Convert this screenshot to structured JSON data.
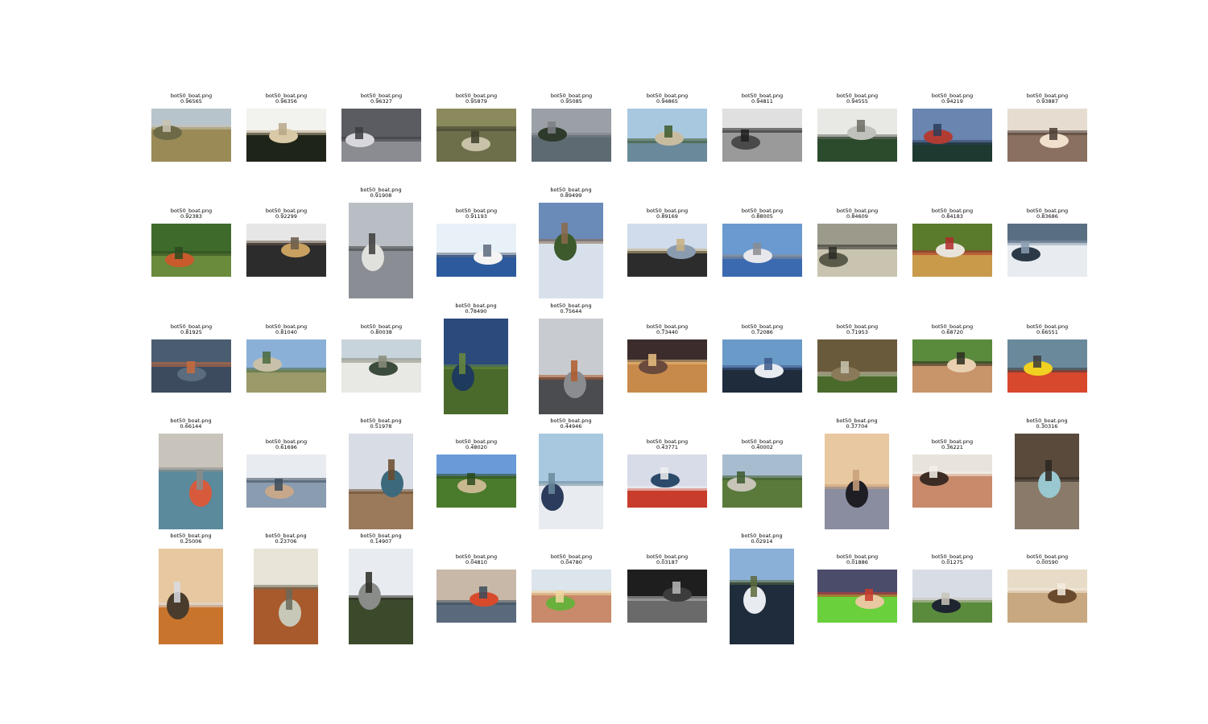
{
  "figure": {
    "cells": [
      {
        "file": "bot50_boat.png",
        "score": "0.96565",
        "orient": "land",
        "palette": [
          "#b8c4cc",
          "#9a8a56",
          "#6d6a48",
          "#c9c3b0"
        ],
        "icon": "landscape-photo"
      },
      {
        "file": "bot50_boat.png",
        "score": "0.96356",
        "orient": "land",
        "palette": [
          "#f2f2ee",
          "#1e2418",
          "#d9c9a6",
          "#b8a888"
        ],
        "icon": "landscape-photo"
      },
      {
        "file": "bot50_boat.png",
        "score": "0.96327",
        "orient": "land",
        "palette": [
          "#5a5c62",
          "#8a8c92",
          "#d8d8dc",
          "#3c3c40"
        ],
        "icon": "landscape-photo"
      },
      {
        "file": "bot50_boat.png",
        "score": "0.95879",
        "orient": "land",
        "palette": [
          "#8a8a5c",
          "#6d6e4a",
          "#c8c2a8",
          "#3e3e2c"
        ],
        "icon": "landscape-photo"
      },
      {
        "file": "bot50_boat.png",
        "score": "0.95085",
        "orient": "land",
        "palette": [
          "#9aa0a6",
          "#5e6a72",
          "#2e3a2c",
          "#7c8086"
        ],
        "icon": "landscape-photo"
      },
      {
        "file": "bot50_boat.png",
        "score": "0.94865",
        "orient": "land",
        "palette": [
          "#a8c8e0",
          "#6a8a9c",
          "#c8bca0",
          "#3e5a2c"
        ],
        "icon": "landscape-photo"
      },
      {
        "file": "bot50_boat.png",
        "score": "0.94811",
        "orient": "land",
        "palette": [
          "#e0e0e0",
          "#9a9a9a",
          "#4a4a4a",
          "#1e1e1e"
        ],
        "icon": "landscape-photo"
      },
      {
        "file": "bot50_boat.png",
        "score": "0.94555",
        "orient": "land",
        "palette": [
          "#e8e8e4",
          "#2c4a2c",
          "#c0c0bc",
          "#6c6c64"
        ],
        "icon": "landscape-photo"
      },
      {
        "file": "bot50_boat.png",
        "score": "0.94219",
        "orient": "land",
        "palette": [
          "#6a86b0",
          "#1e3a30",
          "#b03c34",
          "#2c3e5c"
        ],
        "icon": "landscape-photo"
      },
      {
        "file": "bot50_boat.png",
        "score": "0.93887",
        "orient": "land",
        "palette": [
          "#e6dcd0",
          "#8a7060",
          "#f0e0cc",
          "#4a3c34"
        ],
        "icon": "landscape-photo"
      },
      {
        "file": "bot50_boat.png",
        "score": "0.92383",
        "orient": "land",
        "palette": [
          "#3e6a2c",
          "#6a8a3c",
          "#c85a2c",
          "#2c4a1e"
        ],
        "icon": "landscape-photo"
      },
      {
        "file": "bot50_boat.png",
        "score": "0.92299",
        "orient": "land",
        "palette": [
          "#e6e6e6",
          "#2c2c2c",
          "#c8a060",
          "#6a5a48"
        ],
        "icon": "landscape-photo"
      },
      {
        "file": "bot50_boat.png",
        "score": "0.91908",
        "orient": "tall",
        "palette": [
          "#b8bec4",
          "#8a8e94",
          "#e0e0dc",
          "#3c3c3c"
        ],
        "icon": "portrait-photo"
      },
      {
        "file": "bot50_boat.png",
        "score": "0.91193",
        "orient": "land",
        "palette": [
          "#e8f0f8",
          "#2c5a9c",
          "#f4f4f4",
          "#5a6a7c"
        ],
        "icon": "landscape-photo"
      },
      {
        "file": "bot50_boat.png",
        "score": "0.89499",
        "orient": "tall",
        "palette": [
          "#6a8ab8",
          "#d8e0ec",
          "#3c5a2c",
          "#8a6a4a"
        ],
        "icon": "portrait-photo"
      },
      {
        "file": "bot50_boat.png",
        "score": "0.89169",
        "orient": "land",
        "palette": [
          "#d0dcec",
          "#2c2c2c",
          "#8a9cb0",
          "#c8b080"
        ],
        "icon": "landscape-photo"
      },
      {
        "file": "bot50_boat.png",
        "score": "0.88005",
        "orient": "land",
        "palette": [
          "#6a9ad0",
          "#3c6ab0",
          "#e8e8ec",
          "#8a8c90"
        ],
        "icon": "landscape-photo"
      },
      {
        "file": "bot50_boat.png",
        "score": "0.84609",
        "orient": "land",
        "palette": [
          "#9c9a8a",
          "#c8c4b0",
          "#5a5a4a",
          "#2c2c24"
        ],
        "icon": "landscape-photo"
      },
      {
        "file": "bot50_boat.png",
        "score": "0.84183",
        "orient": "land",
        "palette": [
          "#5a7a2c",
          "#c89a4a",
          "#e8e4dc",
          "#b02c2c"
        ],
        "icon": "landscape-photo"
      },
      {
        "file": "bot50_boat.png",
        "score": "0.83686",
        "orient": "land",
        "palette": [
          "#5a6e82",
          "#e8ecf0",
          "#2c3a48",
          "#8a9cb0"
        ],
        "icon": "landscape-photo"
      },
      {
        "file": "bot50_boat.png",
        "score": "0.81925",
        "orient": "land",
        "palette": [
          "#4a5c70",
          "#3c4c5e",
          "#5a6c7e",
          "#c86a3c"
        ],
        "icon": "landscape-photo"
      },
      {
        "file": "bot50_boat.png",
        "score": "0.81040",
        "orient": "land",
        "palette": [
          "#8ab0d8",
          "#9a9a6a",
          "#c8c0a8",
          "#4a6a3c"
        ],
        "icon": "landscape-photo"
      },
      {
        "file": "bot50_boat.png",
        "score": "0.80038",
        "orient": "land",
        "palette": [
          "#c8d4dc",
          "#e8e8e4",
          "#3c4c3c",
          "#8a8c7c"
        ],
        "icon": "landscape-photo"
      },
      {
        "file": "bot50_boat.png",
        "score": "0.78490",
        "orient": "tall",
        "palette": [
          "#2c4a7c",
          "#4a6a2c",
          "#1e3a5c",
          "#6a8a3c"
        ],
        "icon": "portrait-photo"
      },
      {
        "file": "bot50_boat.png",
        "score": "0.75644",
        "orient": "tall",
        "palette": [
          "#c8ccd0",
          "#4a4c50",
          "#8a8c90",
          "#b05a2c"
        ],
        "icon": "portrait-photo"
      },
      {
        "file": "bot50_boat.png",
        "score": "0.73440",
        "orient": "land",
        "palette": [
          "#3c2c2c",
          "#c88a4a",
          "#6a4a3c",
          "#e8c080"
        ],
        "icon": "landscape-photo"
      },
      {
        "file": "bot50_boat.png",
        "score": "0.72086",
        "orient": "land",
        "palette": [
          "#6a9ac8",
          "#1e2c3c",
          "#e8ecf0",
          "#3c5a8a"
        ],
        "icon": "landscape-photo"
      },
      {
        "file": "bot50_boat.png",
        "score": "0.71953",
        "orient": "land",
        "palette": [
          "#6a5a3c",
          "#4a6a2c",
          "#8a7a5a",
          "#c8c4b0"
        ],
        "icon": "landscape-photo"
      },
      {
        "file": "bot50_boat.png",
        "score": "0.68720",
        "orient": "land",
        "palette": [
          "#5a8a3c",
          "#c8946a",
          "#e8d0b0",
          "#2c2c1e"
        ],
        "icon": "landscape-photo"
      },
      {
        "file": "bot50_boat.png",
        "score": "0.66551",
        "orient": "land",
        "palette": [
          "#6a8a9c",
          "#d8482c",
          "#f0d020",
          "#3c3c3c"
        ],
        "icon": "landscape-photo"
      },
      {
        "file": "bot50_boat.png",
        "score": "0.66144",
        "orient": "tall",
        "palette": [
          "#c8c4bc",
          "#5a8a9c",
          "#d85a3c",
          "#8a8c8a"
        ],
        "icon": "portrait-photo"
      },
      {
        "file": "bot50_boat.png",
        "score": "0.61696",
        "orient": "land",
        "palette": [
          "#e8ecf0",
          "#8a9cb0",
          "#c8a88a",
          "#3c4c5c"
        ],
        "icon": "landscape-photo"
      },
      {
        "file": "bot50_boat.png",
        "score": "0.51978",
        "orient": "tall",
        "palette": [
          "#d8dce4",
          "#9a7a5a",
          "#3c6a7c",
          "#6a4a2c"
        ],
        "icon": "portrait-photo"
      },
      {
        "file": "bot50_boat.png",
        "score": "0.48020",
        "orient": "land",
        "palette": [
          "#6a9ad8",
          "#4a7a2c",
          "#c8b890",
          "#2c4a1e"
        ],
        "icon": "landscape-photo"
      },
      {
        "file": "bot50_boat.png",
        "score": "0.44946",
        "orient": "tall",
        "palette": [
          "#a8c8e0",
          "#e8ecf0",
          "#2c3c5c",
          "#6a8a9c"
        ],
        "icon": "portrait-photo"
      },
      {
        "file": "bot50_boat.png",
        "score": "0.43771",
        "orient": "land",
        "palette": [
          "#d8dce8",
          "#c83c2c",
          "#2c4a6a",
          "#f0f0f0"
        ],
        "icon": "landscape-photo"
      },
      {
        "file": "bot50_boat.png",
        "score": "0.40002",
        "orient": "land",
        "palette": [
          "#a8bcd0",
          "#5a7a3c",
          "#c8c4b8",
          "#3c5a2c"
        ],
        "icon": "landscape-photo"
      },
      {
        "file": "bot50_boat.png",
        "score": "0.37704",
        "orient": "tall",
        "palette": [
          "#e8c8a0",
          "#8a8ca0",
          "#1e1e24",
          "#c8a07a"
        ],
        "icon": "portrait-photo"
      },
      {
        "file": "bot50_boat.png",
        "score": "0.36221",
        "orient": "land",
        "palette": [
          "#e8e4dc",
          "#c88a6a",
          "#3c2c24",
          "#f4f0ea"
        ],
        "icon": "landscape-photo"
      },
      {
        "file": "bot50_boat.png",
        "score": "0.30316",
        "orient": "tall",
        "palette": [
          "#5a4a3c",
          "#8a7a6a",
          "#9ac8d0",
          "#2c2420"
        ],
        "icon": "portrait-photo"
      },
      {
        "file": "bot50_boat.png",
        "score": "0.25006",
        "orient": "tall",
        "palette": [
          "#e8c8a0",
          "#c8742c",
          "#4a3c2c",
          "#d8dce4"
        ],
        "icon": "portrait-photo"
      },
      {
        "file": "bot50_boat.png",
        "score": "0.23706",
        "orient": "tall",
        "palette": [
          "#e8e4d8",
          "#a85a2c",
          "#c8c8b8",
          "#6a6a5a"
        ],
        "icon": "portrait-photo"
      },
      {
        "file": "bot50_boat.png",
        "score": "0.14907",
        "orient": "tall",
        "palette": [
          "#e8ecf0",
          "#3c4a2c",
          "#8a8c8a",
          "#2c2c24"
        ],
        "icon": "portrait-photo"
      },
      {
        "file": "bot50_boat.png",
        "score": "0.04810",
        "orient": "land",
        "palette": [
          "#c8b8a8",
          "#5a6a7c",
          "#d84a2c",
          "#3c4c5c"
        ],
        "icon": "landscape-photo"
      },
      {
        "file": "bot50_boat.png",
        "score": "0.04780",
        "orient": "land",
        "palette": [
          "#dce4ec",
          "#c88a6a",
          "#6ab03c",
          "#f0d8a0"
        ],
        "icon": "landscape-photo"
      },
      {
        "file": "bot50_boat.png",
        "score": "0.03187",
        "orient": "land",
        "palette": [
          "#1e1e1e",
          "#6a6a6a",
          "#3c3c3c",
          "#b8b8b8"
        ],
        "icon": "landscape-photo"
      },
      {
        "file": "bot50_boat.png",
        "score": "0.02914",
        "orient": "tall",
        "palette": [
          "#8ab0d8",
          "#1e2c3c",
          "#e8ecf0",
          "#5a6a3c"
        ],
        "icon": "portrait-photo"
      },
      {
        "file": "bot50_boat.png",
        "score": "0.01886",
        "orient": "land",
        "palette": [
          "#4a4c6a",
          "#6ad03c",
          "#e8c8a0",
          "#c83c2c"
        ],
        "icon": "landscape-photo"
      },
      {
        "file": "bot50_boat.png",
        "score": "0.01275",
        "orient": "land",
        "palette": [
          "#d8dce4",
          "#5a8a3c",
          "#1e2430",
          "#c8c4b8"
        ],
        "icon": "landscape-photo"
      },
      {
        "file": "bot50_boat.png",
        "score": "0.00590",
        "orient": "land",
        "palette": [
          "#e8dcc8",
          "#c8a880",
          "#6a4a2c",
          "#f4ece0"
        ],
        "icon": "landscape-photo"
      }
    ]
  }
}
